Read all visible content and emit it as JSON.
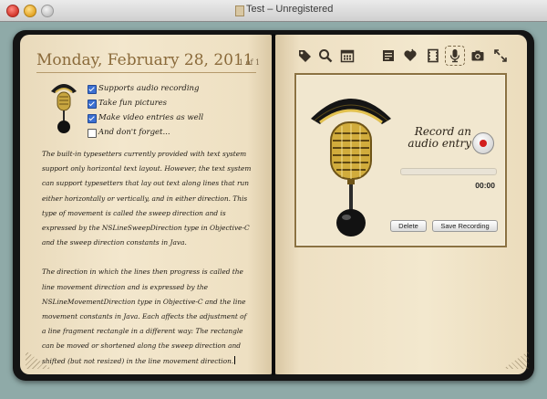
{
  "window": {
    "title": "Test – Unregistered"
  },
  "entry": {
    "date": "Monday, February 28, 2011",
    "page_count": "1 of 1",
    "checklist": [
      {
        "label": "Supports audio recording",
        "checked": true
      },
      {
        "label": "Take fun pictures",
        "checked": true
      },
      {
        "label": "Make video entries as well",
        "checked": true
      },
      {
        "label": "And don't forget...",
        "checked": false
      }
    ],
    "paragraphs": [
      "The built-in typesetters currently provided with text system support only horizontal text layout. However, the text system can support typesetters that lay out text along lines that run either horizontally or vertically, and in either direction. This type of movement is called the sweep direction and is expressed by the NSLineSweepDirection type in Objective-C and the sweep direction constants in Java.",
      "The direction in which the lines then progress is called the line movement direction and is expressed by the NSLineMovementDirection type in Objective-C and the line movement constants in Java. Each affects the adjustment of a line fragment rectangle in a different way: The rectangle can be moved or shortened along the sweep direction and shifted (but not resized) in the line movement direction."
    ]
  },
  "toolbar": {
    "tools": [
      "tag-icon",
      "search-icon",
      "calendar-icon",
      "notes-icon",
      "heart-icon",
      "film-icon",
      "microphone-icon",
      "camera-icon",
      "fullscreen-icon"
    ],
    "active_tool": "microphone-icon"
  },
  "recorder": {
    "title": "Record an audio entry",
    "time": "00:00",
    "progress": 0.0,
    "delete_label": "Delete",
    "save_label": "Save Recording"
  },
  "colors": {
    "page": "#efe2c6",
    "title": "#8a6a3a",
    "panel_border": "#8b7242",
    "record_red": "#d21f1f",
    "window_bg": "#8faaa8"
  }
}
